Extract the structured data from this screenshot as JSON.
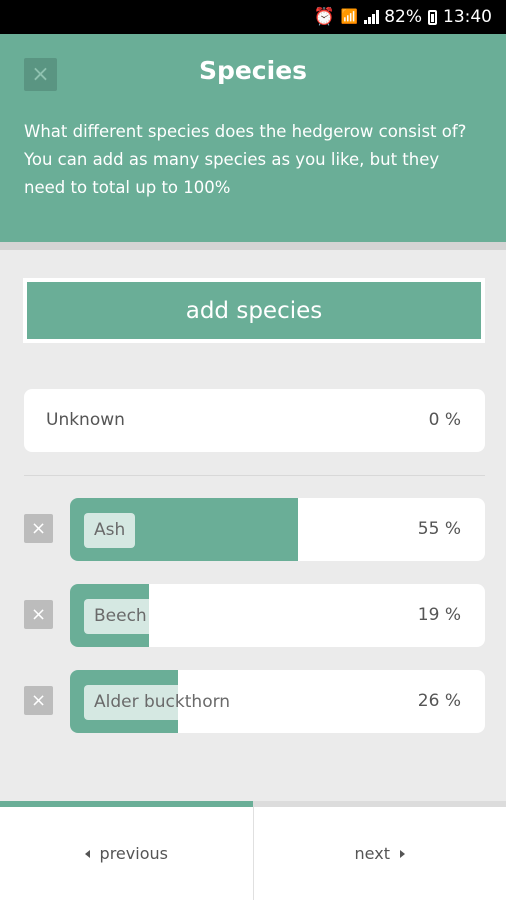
{
  "status_bar": {
    "battery": "82%",
    "time": "13:40",
    "icons": [
      "alarm-icon",
      "wifi-icon",
      "signal-icon",
      "battery-icon"
    ]
  },
  "header": {
    "title": "Species",
    "description": "What different species does the hedgerow consist of? You can add as many species as you like, but they need to total up to 100%",
    "close_icon": "×"
  },
  "add_button": {
    "label": "add species"
  },
  "unknown": {
    "label": "Unknown",
    "percent": "0 %"
  },
  "species": [
    {
      "name": "Ash",
      "percent": "55 %",
      "value": 55
    },
    {
      "name": "Beech",
      "percent": "19 %",
      "value": 19
    },
    {
      "name": "Alder buckthorn",
      "percent": "26 %",
      "value": 26
    }
  ],
  "remove_icon": "×",
  "progress": {
    "fraction": 0.5
  },
  "nav": {
    "previous": "previous",
    "next": "next"
  },
  "colors": {
    "accent": "#6aae97",
    "background": "#ebebeb"
  }
}
